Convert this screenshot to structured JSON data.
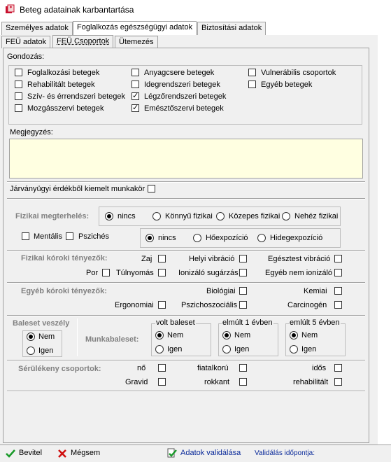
{
  "window": {
    "title": "Beteg adatainak karbantartása"
  },
  "tabs_top": [
    "Személyes adatok",
    "Foglalkozás egészségügyi adatok",
    "Biztosítási adatok"
  ],
  "tabs_sub": [
    "FEÜ adatok",
    "FEÜ Csoportok",
    "Ütemezés"
  ],
  "gondozas": {
    "label": "Gondozás:",
    "items": [
      {
        "label": "Foglalkozási betegek",
        "checked": false
      },
      {
        "label": "Rehabilitált betegek",
        "checked": false
      },
      {
        "label": "Szív- és érrendszeri betegek",
        "checked": false
      },
      {
        "label": "Mozgásszervi betegek",
        "checked": false
      },
      {
        "label": "Anyagcsere betegek",
        "checked": false
      },
      {
        "label": "Idegrendszeri betegek",
        "checked": false
      },
      {
        "label": "Légzőrendszeri betegek",
        "checked": true
      },
      {
        "label": "Emésztőszervi betegek",
        "checked": true
      },
      {
        "label": "Vulnerábilis csoportok",
        "checked": false
      },
      {
        "label": "Egyéb betegek",
        "checked": false
      }
    ]
  },
  "megjegyzes": {
    "label": "Megjegyzés:",
    "value": ""
  },
  "jarvany": {
    "label": "Járványügyi érdékből kiemelt munkakör",
    "checked": false
  },
  "fizikai": {
    "label": "Fizikai megterhelés:",
    "options": [
      "nincs",
      "Könnyű fizikai",
      "Közepes fizikai",
      "Nehéz fizikai"
    ],
    "selected": "nincs"
  },
  "mentalis": {
    "label": "Mentális",
    "checked": false
  },
  "psziches": {
    "label": "Pszichés",
    "checked": false
  },
  "hoexp": {
    "options": [
      "nincs",
      "Hőexpozíció",
      "Hidegexpozíció"
    ],
    "selected": "nincs"
  },
  "fizikai_koroki": {
    "label": "Fizikai kóroki tényezők:",
    "items": [
      "Zaj",
      "Helyi vibráció",
      "Egésztest vibráció",
      "Por",
      "Túlnyomás",
      "Ionizáló sugárzás",
      "Egyéb nem ionizáló"
    ]
  },
  "egyeb_koroki": {
    "label": "Egyéb kóroki tényezők:",
    "items": [
      "Biológiai",
      "Kemiai",
      "Ergonomiai",
      "Pszichoszociális",
      "Carcinogén"
    ]
  },
  "baleset": {
    "label": "Baleset veszély",
    "options": [
      "Nem",
      "Igen"
    ],
    "selected": "Nem"
  },
  "munkabaleset": {
    "label": "Munkabaleset:",
    "groups": [
      {
        "title": "volt baleset",
        "options": [
          "Nem",
          "Igen"
        ],
        "selected": "Nem"
      },
      {
        "title": "elmúlt 1 évben",
        "options": [
          "Nem",
          "Igen"
        ],
        "selected": "Nem"
      },
      {
        "title": "emlúlt 5 évben",
        "options": [
          "Nem",
          "Igen"
        ],
        "selected": "Nem"
      }
    ]
  },
  "serulekeny": {
    "label": "Sérülékeny csoportok:",
    "items": [
      "nő",
      "fiatalkorú",
      "idős",
      "Gravid",
      "rokkant",
      "rehabilitált"
    ]
  },
  "bottom": {
    "bevitel": "Bevitel",
    "megsem": "Mégsem",
    "validalas": "Adatok validálása",
    "validalas_idopont": "Validálás időpontja:"
  },
  "colors": {
    "accent_green": "#1a9a2a",
    "cancel_red": "#d01010",
    "link_blue": "#0a2a9a"
  }
}
